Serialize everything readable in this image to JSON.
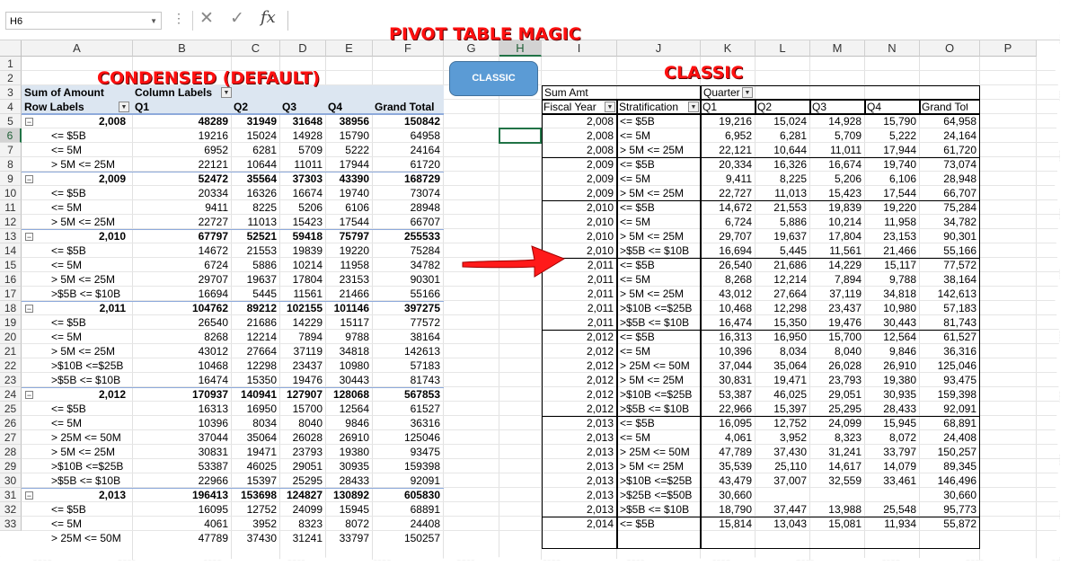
{
  "formula_bar": {
    "name_box": "H6",
    "formula": ""
  },
  "column_headers": [
    "A",
    "B",
    "C",
    "D",
    "E",
    "F",
    "G",
    "H",
    "I",
    "J",
    "K",
    "L",
    "M",
    "N",
    "O",
    "P"
  ],
  "row_numbers": [
    "1",
    "2",
    "3",
    "4",
    "5",
    "6",
    "7",
    "8",
    "9",
    "10",
    "11",
    "12",
    "13",
    "14",
    "15",
    "16",
    "17",
    "18",
    "19",
    "20",
    "21",
    "22",
    "23",
    "24",
    "25",
    "26",
    "27",
    "28",
    "29",
    "30",
    "31",
    "32",
    "33"
  ],
  "selected_cell": "H6",
  "titles": {
    "main": "PIVOT TABLE MAGIC",
    "condensed": "CONDENSED (DEFAULT)",
    "classic": "CLASSIC"
  },
  "classic_button": {
    "label": "CLASSIC"
  },
  "condensed": {
    "sum_label": "Sum of Amount",
    "col_labels": "Column Labels",
    "row_labels": "Row Labels",
    "headers": [
      "Q1",
      "Q2",
      "Q3",
      "Q4",
      "Grand Total"
    ],
    "rows": [
      {
        "label": "2,008",
        "vals": [
          "48289",
          "31949",
          "31648",
          "38956",
          "150842"
        ],
        "group": true
      },
      {
        "label": "<= $5B",
        "vals": [
          "19216",
          "15024",
          "14928",
          "15790",
          "64958"
        ]
      },
      {
        "label": "<= 5M",
        "vals": [
          "6952",
          "6281",
          "5709",
          "5222",
          "24164"
        ]
      },
      {
        "label": "> 5M <= 25M",
        "vals": [
          "22121",
          "10644",
          "11011",
          "17944",
          "61720"
        ]
      },
      {
        "label": "2,009",
        "vals": [
          "52472",
          "35564",
          "37303",
          "43390",
          "168729"
        ],
        "group": true
      },
      {
        "label": "<= $5B",
        "vals": [
          "20334",
          "16326",
          "16674",
          "19740",
          "73074"
        ]
      },
      {
        "label": "<= 5M",
        "vals": [
          "9411",
          "8225",
          "5206",
          "6106",
          "28948"
        ]
      },
      {
        "label": "> 5M <= 25M",
        "vals": [
          "22727",
          "11013",
          "15423",
          "17544",
          "66707"
        ]
      },
      {
        "label": "2,010",
        "vals": [
          "67797",
          "52521",
          "59418",
          "75797",
          "255533"
        ],
        "group": true
      },
      {
        "label": "<= $5B",
        "vals": [
          "14672",
          "21553",
          "19839",
          "19220",
          "75284"
        ]
      },
      {
        "label": "<= 5M",
        "vals": [
          "6724",
          "5886",
          "10214",
          "11958",
          "34782"
        ]
      },
      {
        "label": "> 5M <= 25M",
        "vals": [
          "29707",
          "19637",
          "17804",
          "23153",
          "90301"
        ]
      },
      {
        "label": ">$5B <= $10B",
        "vals": [
          "16694",
          "5445",
          "11561",
          "21466",
          "55166"
        ]
      },
      {
        "label": "2,011",
        "vals": [
          "104762",
          "89212",
          "102155",
          "101146",
          "397275"
        ],
        "group": true
      },
      {
        "label": "<= $5B",
        "vals": [
          "26540",
          "21686",
          "14229",
          "15117",
          "77572"
        ]
      },
      {
        "label": "<= 5M",
        "vals": [
          "8268",
          "12214",
          "7894",
          "9788",
          "38164"
        ]
      },
      {
        "label": "> 5M <= 25M",
        "vals": [
          "43012",
          "27664",
          "37119",
          "34818",
          "142613"
        ]
      },
      {
        "label": ">$10B <=$25B",
        "vals": [
          "10468",
          "12298",
          "23437",
          "10980",
          "57183"
        ]
      },
      {
        "label": ">$5B <= $10B",
        "vals": [
          "16474",
          "15350",
          "19476",
          "30443",
          "81743"
        ]
      },
      {
        "label": "2,012",
        "vals": [
          "170937",
          "140941",
          "127907",
          "128068",
          "567853"
        ],
        "group": true
      },
      {
        "label": "<= $5B",
        "vals": [
          "16313",
          "16950",
          "15700",
          "12564",
          "61527"
        ]
      },
      {
        "label": "<= 5M",
        "vals": [
          "10396",
          "8034",
          "8040",
          "9846",
          "36316"
        ]
      },
      {
        "label": "> 25M <= 50M",
        "vals": [
          "37044",
          "35064",
          "26028",
          "26910",
          "125046"
        ]
      },
      {
        "label": "> 5M <= 25M",
        "vals": [
          "30831",
          "19471",
          "23793",
          "19380",
          "93475"
        ]
      },
      {
        "label": ">$10B <=$25B",
        "vals": [
          "53387",
          "46025",
          "29051",
          "30935",
          "159398"
        ]
      },
      {
        "label": ">$5B <= $10B",
        "vals": [
          "22966",
          "15397",
          "25295",
          "28433",
          "92091"
        ]
      },
      {
        "label": "2,013",
        "vals": [
          "196413",
          "153698",
          "124827",
          "130892",
          "605830"
        ],
        "group": true
      },
      {
        "label": "<= $5B",
        "vals": [
          "16095",
          "12752",
          "24099",
          "15945",
          "68891"
        ]
      },
      {
        "label": "<= 5M",
        "vals": [
          "4061",
          "3952",
          "8323",
          "8072",
          "24408"
        ]
      },
      {
        "label": "> 25M <= 50M",
        "vals": [
          "47789",
          "37430",
          "31241",
          "33797",
          "150257"
        ]
      }
    ]
  },
  "classic": {
    "sum_label": "Sum Amt",
    "quarter_label": "Quarter",
    "headers": [
      "Fiscal Year",
      "Stratification",
      "Q1",
      "Q2",
      "Q3",
      "Q4",
      "Grand Total"
    ],
    "rows": [
      [
        "2,008",
        "<= $5B",
        "19,216",
        "15,024",
        "14,928",
        "15,790",
        "64,958"
      ],
      [
        "2,008",
        "<= 5M",
        "6,952",
        "6,281",
        "5,709",
        "5,222",
        "24,164"
      ],
      [
        "2,008",
        "> 5M <= 25M",
        "22,121",
        "10,644",
        "11,011",
        "17,944",
        "61,720"
      ],
      [
        "2,009",
        "<= $5B",
        "20,334",
        "16,326",
        "16,674",
        "19,740",
        "73,074"
      ],
      [
        "2,009",
        "<= 5M",
        "9,411",
        "8,225",
        "5,206",
        "6,106",
        "28,948"
      ],
      [
        "2,009",
        "> 5M <= 25M",
        "22,727",
        "11,013",
        "15,423",
        "17,544",
        "66,707"
      ],
      [
        "2,010",
        "<= $5B",
        "14,672",
        "21,553",
        "19,839",
        "19,220",
        "75,284"
      ],
      [
        "2,010",
        "<= 5M",
        "6,724",
        "5,886",
        "10,214",
        "11,958",
        "34,782"
      ],
      [
        "2,010",
        "> 5M <= 25M",
        "29,707",
        "19,637",
        "17,804",
        "23,153",
        "90,301"
      ],
      [
        "2,010",
        ">$5B <= $10B",
        "16,694",
        "5,445",
        "11,561",
        "21,466",
        "55,166"
      ],
      [
        "2,011",
        "<= $5B",
        "26,540",
        "21,686",
        "14,229",
        "15,117",
        "77,572"
      ],
      [
        "2,011",
        "<= 5M",
        "8,268",
        "12,214",
        "7,894",
        "9,788",
        "38,164"
      ],
      [
        "2,011",
        "> 5M <= 25M",
        "43,012",
        "27,664",
        "37,119",
        "34,818",
        "142,613"
      ],
      [
        "2,011",
        ">$10B <=$25B",
        "10,468",
        "12,298",
        "23,437",
        "10,980",
        "57,183"
      ],
      [
        "2,011",
        ">$5B <= $10B",
        "16,474",
        "15,350",
        "19,476",
        "30,443",
        "81,743"
      ],
      [
        "2,012",
        "<= $5B",
        "16,313",
        "16,950",
        "15,700",
        "12,564",
        "61,527"
      ],
      [
        "2,012",
        "<= 5M",
        "10,396",
        "8,034",
        "8,040",
        "9,846",
        "36,316"
      ],
      [
        "2,012",
        "> 25M <= 50M",
        "37,044",
        "35,064",
        "26,028",
        "26,910",
        "125,046"
      ],
      [
        "2,012",
        "> 5M <= 25M",
        "30,831",
        "19,471",
        "23,793",
        "19,380",
        "93,475"
      ],
      [
        "2,012",
        ">$10B <=$25B",
        "53,387",
        "46,025",
        "29,051",
        "30,935",
        "159,398"
      ],
      [
        "2,012",
        ">$5B <= $10B",
        "22,966",
        "15,397",
        "25,295",
        "28,433",
        "92,091"
      ],
      [
        "2,013",
        "<= $5B",
        "16,095",
        "12,752",
        "24,099",
        "15,945",
        "68,891"
      ],
      [
        "2,013",
        "<= 5M",
        "4,061",
        "3,952",
        "8,323",
        "8,072",
        "24,408"
      ],
      [
        "2,013",
        "> 25M <= 50M",
        "47,789",
        "37,430",
        "31,241",
        "33,797",
        "150,257"
      ],
      [
        "2,013",
        "> 5M <= 25M",
        "35,539",
        "25,110",
        "14,617",
        "14,079",
        "89,345"
      ],
      [
        "2,013",
        ">$10B <=$25B",
        "43,479",
        "37,007",
        "32,559",
        "33,461",
        "146,496"
      ],
      [
        "2,013",
        ">$25B <=$50B",
        "30,660",
        "",
        "",
        "",
        "30,660"
      ],
      [
        "2,013",
        ">$5B <= $10B",
        "18,790",
        "",
        "37,447",
        "13,988",
        "25,548",
        "95,773"
      ],
      [
        "2,014",
        "<= $5B",
        "15,814",
        "13,043",
        "15,081",
        "11,934",
        "55,872"
      ]
    ]
  }
}
